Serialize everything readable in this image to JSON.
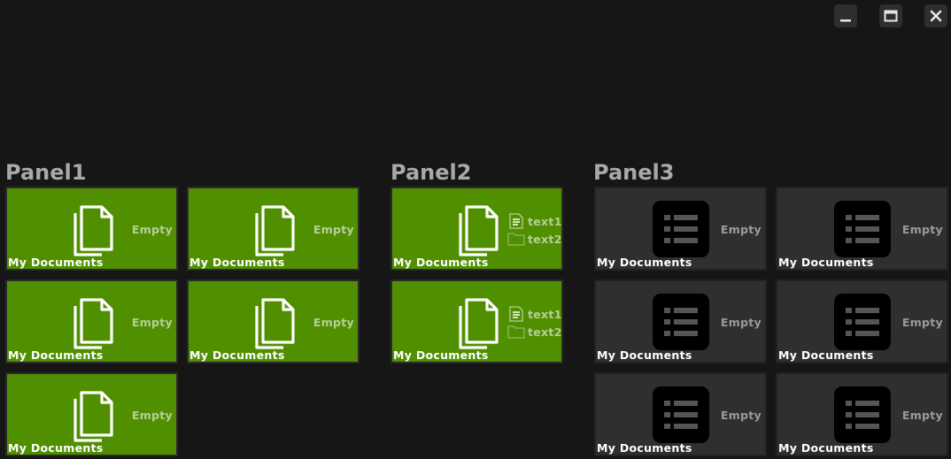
{
  "window_controls": [
    {
      "name": "minimize-button",
      "icon": "minimize-icon"
    },
    {
      "name": "maximize-button",
      "icon": "maximize-icon"
    },
    {
      "name": "close-button",
      "icon": "close-icon"
    }
  ],
  "panels": [
    {
      "title": "Panel1",
      "tiles": [
        {
          "label": "My Documents",
          "status": "Empty",
          "icon": "documents-icon"
        },
        {
          "label": "My Documents",
          "status": "Empty",
          "icon": "documents-icon"
        },
        {
          "label": "My Documents",
          "status": "Empty",
          "icon": "documents-icon"
        },
        {
          "label": "My Documents",
          "status": "Empty",
          "icon": "documents-icon"
        },
        {
          "label": "My Documents",
          "status": "Empty",
          "icon": "documents-icon"
        }
      ]
    },
    {
      "title": "Panel2",
      "tiles": [
        {
          "label": "My Documents",
          "icon": "documents-icon",
          "files": [
            {
              "name": "text1",
              "icon": "text-file-icon"
            },
            {
              "name": "text2",
              "icon": "folder-icon"
            }
          ]
        },
        {
          "label": "My Documents",
          "icon": "documents-icon",
          "files": [
            {
              "name": "text1",
              "icon": "text-file-icon"
            },
            {
              "name": "text2",
              "icon": "folder-icon"
            }
          ]
        }
      ]
    },
    {
      "title": "Panel3",
      "tiles": [
        {
          "label": "My Documents",
          "status": "Empty",
          "icon": "list-icon"
        },
        {
          "label": "My Documents",
          "status": "Empty",
          "icon": "list-icon"
        },
        {
          "label": "My Documents",
          "status": "Empty",
          "icon": "list-icon"
        },
        {
          "label": "My Documents",
          "status": "Empty",
          "icon": "list-icon"
        },
        {
          "label": "My Documents",
          "status": "Empty",
          "icon": "list-icon"
        },
        {
          "label": "My Documents",
          "status": "Empty",
          "icon": "list-icon"
        }
      ]
    }
  ],
  "colors": {
    "background": "#161616",
    "tile_green": "#4f8f00",
    "tile_dark": "#2f2f2f",
    "panel_title": "#a9a9a9"
  }
}
